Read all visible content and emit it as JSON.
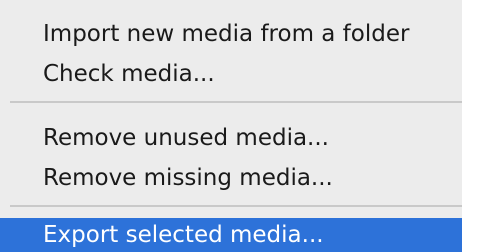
{
  "menu": {
    "items": [
      {
        "label": "Import new media from a folder"
      },
      {
        "label": "Check media..."
      },
      {
        "label": "Remove unused media..."
      },
      {
        "label": "Remove missing media..."
      },
      {
        "label": "Export selected media..."
      }
    ],
    "selected_index": 4,
    "colors": {
      "background": "#ececec",
      "text": "#1a1a1a",
      "selected_background": "#2d72d9",
      "selected_text": "#ffffff",
      "separator": "#c9c9c9"
    }
  }
}
